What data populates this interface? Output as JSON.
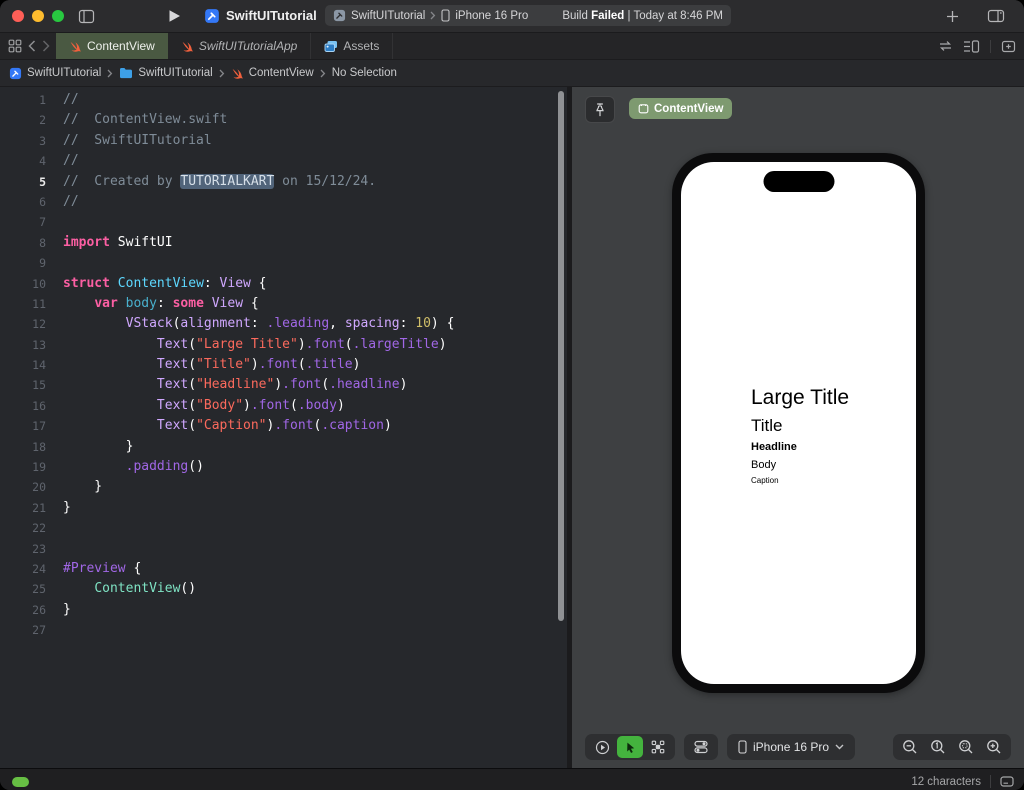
{
  "toolbar": {
    "project_title": "SwiftUITutorial",
    "scheme": "SwiftUITutorial",
    "run_destination": "iPhone 16 Pro",
    "build_status": {
      "prefix": "Build ",
      "failed": "Failed",
      "suffix": " | Today at 8:46 PM"
    }
  },
  "tab_bar": {
    "tabs": [
      {
        "label": "ContentView",
        "icon": "swift-file-icon",
        "active": true
      },
      {
        "label": "SwiftUITutorialApp",
        "icon": "swift-file-icon",
        "italic": true
      },
      {
        "label": "Assets",
        "icon": "assets-icon"
      }
    ]
  },
  "jump_bar": {
    "items": [
      {
        "label": "SwiftUITutorial",
        "icon": "app-target-icon"
      },
      {
        "label": "SwiftUITutorial",
        "icon": "folder-icon"
      },
      {
        "label": "ContentView",
        "icon": "swift-file-icon"
      },
      {
        "label": "No Selection"
      }
    ]
  },
  "editor": {
    "lines": [
      {
        "n": 1,
        "seg": [
          [
            "cm",
            "//"
          ]
        ]
      },
      {
        "n": 2,
        "seg": [
          [
            "cm",
            "//  ContentView.swift"
          ]
        ]
      },
      {
        "n": 3,
        "seg": [
          [
            "cm",
            "//  SwiftUITutorial"
          ]
        ]
      },
      {
        "n": 4,
        "seg": [
          [
            "cm",
            "//"
          ]
        ]
      },
      {
        "n": 5,
        "active": true,
        "seg": [
          [
            "cm",
            "//  Created by "
          ],
          [
            "cm hl",
            "TUTORIALKART"
          ],
          [
            "cm",
            " on 15/12/24."
          ]
        ]
      },
      {
        "n": 6,
        "seg": [
          [
            "cm",
            "//"
          ]
        ]
      },
      {
        "n": 7,
        "seg": []
      },
      {
        "n": 8,
        "seg": [
          [
            "kw",
            "import"
          ],
          [
            "pl",
            " SwiftUI"
          ]
        ]
      },
      {
        "n": 9,
        "seg": []
      },
      {
        "n": 10,
        "seg": [
          [
            "kw",
            "struct"
          ],
          [
            "pl",
            " "
          ],
          [
            "decl",
            "ContentView"
          ],
          [
            "pl",
            ": "
          ],
          [
            "ty",
            "View"
          ],
          [
            "pl",
            " {"
          ]
        ]
      },
      {
        "n": 11,
        "seg": [
          [
            "pl",
            "    "
          ],
          [
            "kw",
            "var"
          ],
          [
            "pl",
            " "
          ],
          [
            "decl2",
            "body"
          ],
          [
            "pl",
            ": "
          ],
          [
            "kw",
            "some"
          ],
          [
            "pl",
            " "
          ],
          [
            "ty",
            "View"
          ],
          [
            "pl",
            " {"
          ]
        ]
      },
      {
        "n": 12,
        "seg": [
          [
            "pl",
            "        "
          ],
          [
            "ty",
            "VStack"
          ],
          [
            "pl",
            "("
          ],
          [
            "ty",
            "alignment"
          ],
          [
            "pl",
            ": "
          ],
          [
            "mem",
            ".leading"
          ],
          [
            "pl",
            ", "
          ],
          [
            "ty",
            "spacing"
          ],
          [
            "pl",
            ": "
          ],
          [
            "num",
            "10"
          ],
          [
            "pl",
            ") {"
          ]
        ]
      },
      {
        "n": 13,
        "seg": [
          [
            "pl",
            "            "
          ],
          [
            "ty",
            "Text"
          ],
          [
            "pl",
            "("
          ],
          [
            "str",
            "\"Large Title\""
          ],
          [
            "pl",
            ")"
          ],
          [
            "mem",
            ".font"
          ],
          [
            "pl",
            "("
          ],
          [
            "mem",
            ".largeTitle"
          ],
          [
            "pl",
            ")"
          ]
        ]
      },
      {
        "n": 14,
        "seg": [
          [
            "pl",
            "            "
          ],
          [
            "ty",
            "Text"
          ],
          [
            "pl",
            "("
          ],
          [
            "str",
            "\"Title\""
          ],
          [
            "pl",
            ")"
          ],
          [
            "mem",
            ".font"
          ],
          [
            "pl",
            "("
          ],
          [
            "mem",
            ".title"
          ],
          [
            "pl",
            ")"
          ]
        ]
      },
      {
        "n": 15,
        "seg": [
          [
            "pl",
            "            "
          ],
          [
            "ty",
            "Text"
          ],
          [
            "pl",
            "("
          ],
          [
            "str",
            "\"Headline\""
          ],
          [
            "pl",
            ")"
          ],
          [
            "mem",
            ".font"
          ],
          [
            "pl",
            "("
          ],
          [
            "mem",
            ".headline"
          ],
          [
            "pl",
            ")"
          ]
        ]
      },
      {
        "n": 16,
        "seg": [
          [
            "pl",
            "            "
          ],
          [
            "ty",
            "Text"
          ],
          [
            "pl",
            "("
          ],
          [
            "str",
            "\"Body\""
          ],
          [
            "pl",
            ")"
          ],
          [
            "mem",
            ".font"
          ],
          [
            "pl",
            "("
          ],
          [
            "mem",
            ".body"
          ],
          [
            "pl",
            ")"
          ]
        ]
      },
      {
        "n": 17,
        "seg": [
          [
            "pl",
            "            "
          ],
          [
            "ty",
            "Text"
          ],
          [
            "pl",
            "("
          ],
          [
            "str",
            "\"Caption\""
          ],
          [
            "pl",
            ")"
          ],
          [
            "mem",
            ".font"
          ],
          [
            "pl",
            "("
          ],
          [
            "mem",
            ".caption"
          ],
          [
            "pl",
            ")"
          ]
        ]
      },
      {
        "n": 18,
        "seg": [
          [
            "pl",
            "        }"
          ]
        ]
      },
      {
        "n": 19,
        "seg": [
          [
            "pl",
            "        "
          ],
          [
            "mem",
            ".padding"
          ],
          [
            "pl",
            "()"
          ]
        ]
      },
      {
        "n": 20,
        "seg": [
          [
            "pl",
            "    }"
          ]
        ]
      },
      {
        "n": 21,
        "seg": [
          [
            "pl",
            "}"
          ]
        ]
      },
      {
        "n": 22,
        "seg": []
      },
      {
        "n": 23,
        "seg": []
      },
      {
        "n": 24,
        "seg": [
          [
            "mem",
            "#Preview"
          ],
          [
            "pl",
            " {"
          ]
        ]
      },
      {
        "n": 25,
        "seg": [
          [
            "pl",
            "    "
          ],
          [
            "mint",
            "ContentView"
          ],
          [
            "pl",
            "()"
          ]
        ]
      },
      {
        "n": 26,
        "seg": [
          [
            "pl",
            "}"
          ]
        ]
      },
      {
        "n": 27,
        "seg": []
      }
    ]
  },
  "preview": {
    "chip_label": "ContentView",
    "device_label": "iPhone 16 Pro",
    "phone_texts": [
      {
        "text": "Large Title",
        "size": 21,
        "weight": 400
      },
      {
        "text": "Title",
        "size": 17,
        "weight": 400
      },
      {
        "text": "Headline",
        "size": 11,
        "weight": 700
      },
      {
        "text": "Body",
        "size": 11,
        "weight": 400
      },
      {
        "text": "Caption",
        "size": 8,
        "weight": 400
      }
    ],
    "mode_buttons": [
      {
        "icon": "play-circle-icon",
        "active": false
      },
      {
        "icon": "cursor-arrow-icon",
        "active": true
      },
      {
        "icon": "variants-grid-icon",
        "active": false
      }
    ],
    "zoom_controls": [
      {
        "icon": "zoom-out-icon"
      },
      {
        "icon": "zoom-100-icon"
      },
      {
        "icon": "zoom-fit-icon"
      },
      {
        "icon": "zoom-in-icon"
      }
    ]
  },
  "status_bar": {
    "characters": "12 characters"
  },
  "colors": {
    "tab_active_green": "#4a5942",
    "chip_green": "#7e9a70",
    "mode_green": "#44b33e",
    "swift_orange": "#f0603d",
    "app_blue": "#3478f6",
    "build_pill": "#3c3d3f"
  }
}
